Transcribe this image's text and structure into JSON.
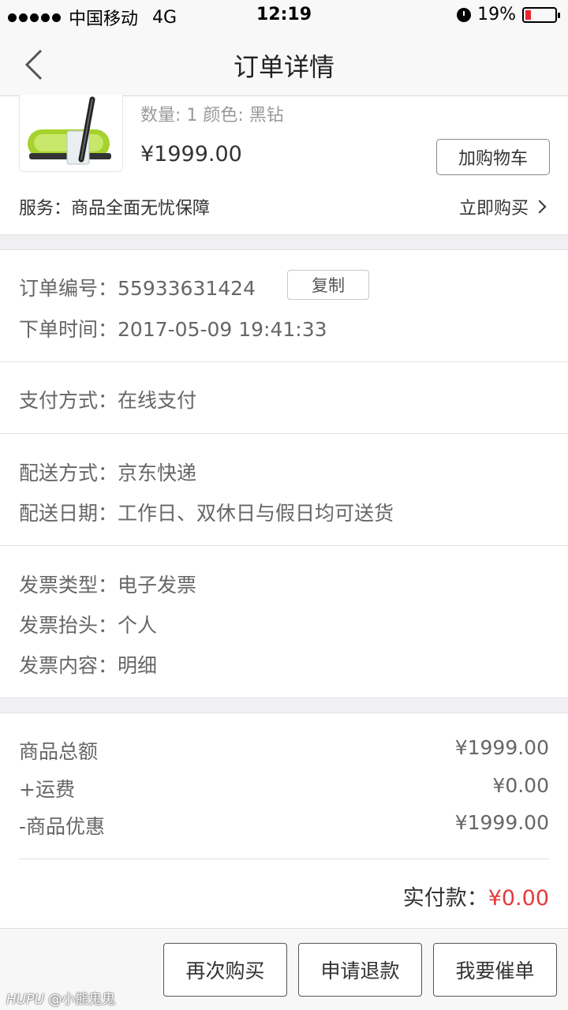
{
  "status_bar": {
    "carrier": "中国移动",
    "network": "4G",
    "time": "12:19",
    "battery": "19%",
    "battery_level": 0.19
  },
  "nav": {
    "title": "订单详情"
  },
  "product": {
    "spec": "数量: 1 颜色: 黑钻",
    "price": "¥1999.00",
    "add_cart_label": "加购物车",
    "service_label": "服务：商品全面无忧保障",
    "buy_now_label": "立即购买"
  },
  "order": {
    "number_label": "订单编号：",
    "number": "55933631424",
    "copy_label": "复制",
    "time_label": "下单时间：",
    "time": "2017-05-09 19:41:33"
  },
  "payment": {
    "label": "支付方式：",
    "value": "在线支付"
  },
  "delivery": {
    "method_label": "配送方式：",
    "method": "京东快递",
    "date_label": "配送日期：",
    "date": "工作日、双休日与假日均可送货"
  },
  "invoice": {
    "type_label": "发票类型：",
    "type": "电子发票",
    "title_label": "发票抬头：",
    "title": "个人",
    "content_label": "发票内容：",
    "content": "明细"
  },
  "summary": {
    "goods_total_label": "商品总额",
    "goods_total": "¥1999.00",
    "shipping_label": "+运费",
    "shipping": "¥0.00",
    "discount_label": "-商品优惠",
    "discount": "¥1999.00",
    "paid_label": "实付款：",
    "paid": "¥0.00"
  },
  "actions": {
    "rebuy": "再次购买",
    "refund": "申请退款",
    "urge": "我要催单"
  },
  "watermark": {
    "brand": "HUPU",
    "author": "@小熊鬼鬼"
  },
  "colors": {
    "accent_red": "#e4393c",
    "gap_bg": "#f0f0f3"
  }
}
